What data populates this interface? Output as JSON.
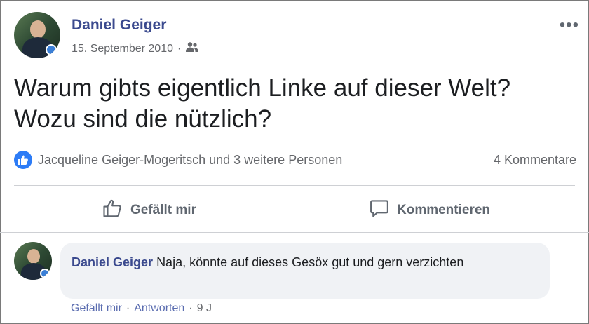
{
  "post": {
    "author": "Daniel Geiger",
    "date": "15. September 2010",
    "separator": "·",
    "audience_icon": "friends-icon",
    "more_icon": "•••",
    "text": "Warum gibts eigentlich Linke auf dieser Welt? Wozu sind die nützlich?",
    "reactions_text": "Jacqueline Geiger-Mogeritsch und 3 weitere Personen",
    "comment_count": "4 Kommentare"
  },
  "actions": {
    "like_label": "Gefällt mir",
    "comment_label": "Kommentieren"
  },
  "comment": {
    "author": "Daniel Geiger",
    "text": "Naja, könnte auf dieses Gesöx gut und gern verzichten",
    "like_label": "Gefällt mir",
    "sep1": "·",
    "reply_label": "Antworten",
    "sep2": "·",
    "age": "9 J"
  },
  "colors": {
    "author_link": "#3b4a8e",
    "like_blue": "#2d7cf6",
    "muted": "#65676b"
  }
}
